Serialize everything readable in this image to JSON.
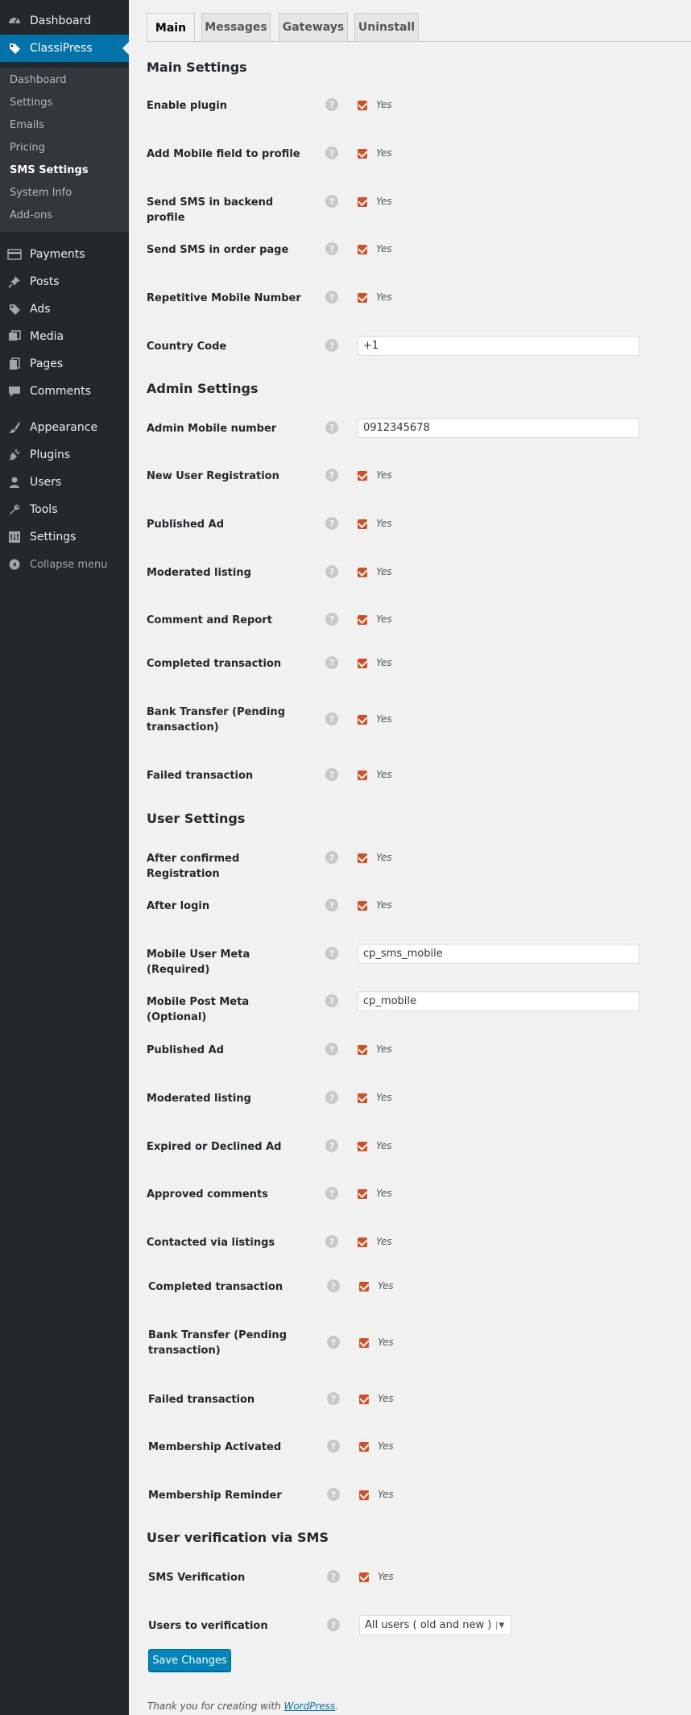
{
  "sidebar": {
    "top": [
      {
        "label": "Dashboard",
        "icon": "dashboard-icon"
      },
      {
        "label": "ClassiPress",
        "icon": "tag-icon"
      }
    ],
    "submenu": [
      "Dashboard",
      "Settings",
      "Emails",
      "Pricing",
      "SMS Settings",
      "System Info",
      "Add-ons"
    ],
    "items": [
      {
        "label": "Payments",
        "icon": "card-icon"
      },
      {
        "label": "Posts",
        "icon": "pin-icon"
      },
      {
        "label": "Ads",
        "icon": "tag-icon"
      },
      {
        "label": "Media",
        "icon": "media-icon"
      },
      {
        "label": "Pages",
        "icon": "pages-icon"
      },
      {
        "label": "Comments",
        "icon": "comment-icon"
      },
      {
        "label": "Appearance",
        "icon": "brush-icon"
      },
      {
        "label": "Plugins",
        "icon": "plugin-icon"
      },
      {
        "label": "Users",
        "icon": "user-icon"
      },
      {
        "label": "Tools",
        "icon": "wrench-icon"
      },
      {
        "label": "Settings",
        "icon": "settings-icon"
      }
    ],
    "collapse": "Collapse menu"
  },
  "tabs": [
    "Main",
    "Messages",
    "Gateways",
    "Uninstall"
  ],
  "sections": {
    "main": "Main Settings",
    "admin": "Admin Settings",
    "user": "User Settings",
    "verify": "User verification via SMS"
  },
  "yes_label": "Yes",
  "help_glyph": "?",
  "rows": {
    "main": [
      {
        "label": "Enable plugin",
        "type": "checkbox"
      },
      {
        "label": "Add Mobile field to profile",
        "type": "checkbox"
      },
      {
        "label": "Send SMS in backend profile",
        "type": "checkbox"
      },
      {
        "label": "Send SMS in order page",
        "type": "checkbox"
      },
      {
        "label": "Repetitive Mobile Number",
        "type": "checkbox"
      },
      {
        "label": "Country Code",
        "type": "text",
        "value": "+1"
      }
    ],
    "admin": [
      {
        "label": "Admin Mobile number",
        "type": "text",
        "value": "0912345678"
      },
      {
        "label": "New User Registration",
        "type": "checkbox"
      },
      {
        "label": "Published Ad",
        "type": "checkbox"
      },
      {
        "label": "Moderated listing",
        "type": "checkbox"
      },
      {
        "label": "Comment and Report",
        "type": "checkbox"
      },
      {
        "label": "Completed transaction",
        "type": "checkbox"
      },
      {
        "label": "Bank Transfer (Pending transaction)",
        "type": "checkbox"
      },
      {
        "label": "Failed transaction",
        "type": "checkbox"
      }
    ],
    "user": [
      {
        "label": "After confirmed Registration",
        "type": "checkbox"
      },
      {
        "label": "After login",
        "type": "checkbox"
      },
      {
        "label": "Mobile User Meta (Required)",
        "type": "text",
        "value": "cp_sms_mobile"
      },
      {
        "label": "Mobile Post Meta (Optional)",
        "type": "text",
        "value": "cp_mobile"
      },
      {
        "label": "Published Ad",
        "type": "checkbox"
      },
      {
        "label": "Moderated listing",
        "type": "checkbox"
      },
      {
        "label": "Expired or Declined Ad",
        "type": "checkbox"
      },
      {
        "label": "Approved comments",
        "type": "checkbox"
      },
      {
        "label": "Contacted via listings",
        "type": "checkbox"
      },
      {
        "label": "Completed transaction",
        "type": "checkbox"
      },
      {
        "label": "Bank Transfer (Pending transaction)",
        "type": "checkbox"
      },
      {
        "label": "Failed transaction",
        "type": "checkbox"
      },
      {
        "label": "Membership Activated",
        "type": "checkbox"
      },
      {
        "label": "Membership Reminder",
        "type": "checkbox"
      }
    ],
    "verify": [
      {
        "label": "SMS Verification",
        "type": "checkbox"
      },
      {
        "label": "Users to verification",
        "type": "select",
        "value": "All users ( old and new )"
      }
    ]
  },
  "save_label": "Save Changes",
  "footer": {
    "text": "Thank you for creating with ",
    "link": "WordPress",
    "end": "."
  },
  "colors": {
    "accent": "#0073aa",
    "checkbox": "#d54e21",
    "sidebar": "#23282d"
  }
}
